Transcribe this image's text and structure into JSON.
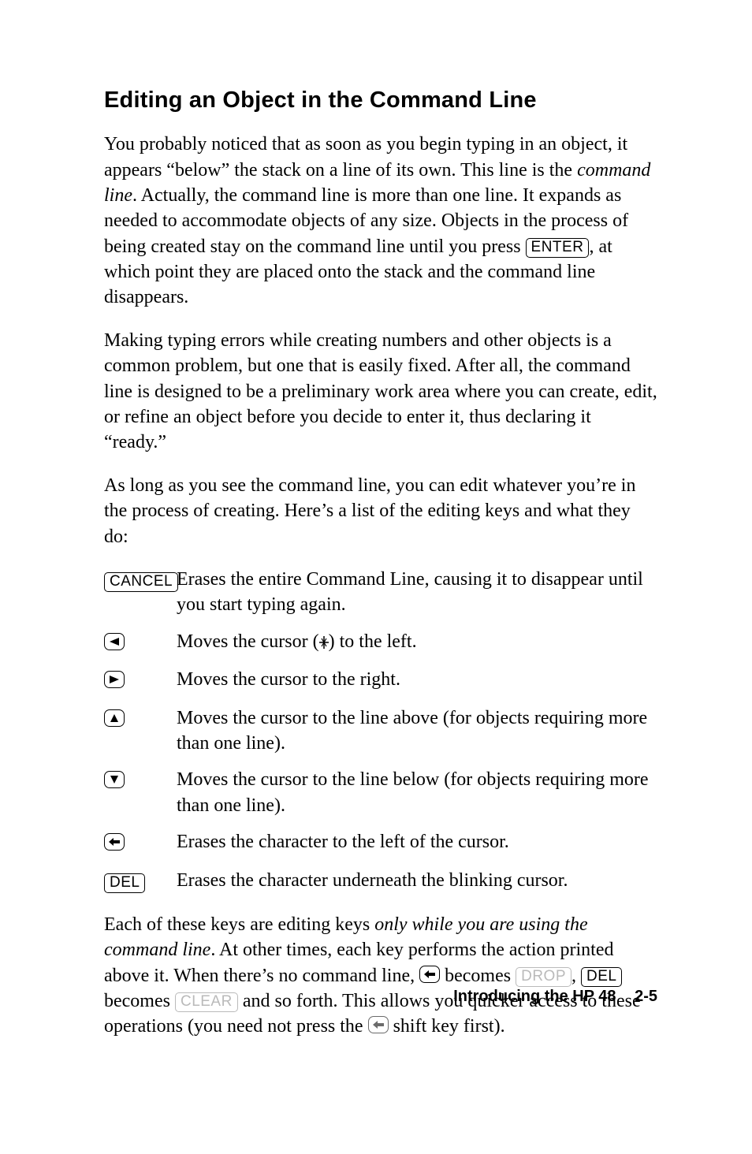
{
  "title": "Editing an Object in the Command Line",
  "p1a": "You probably noticed that as soon as you begin typing in an object, it appears “below” the stack on a line of its own. This line is the ",
  "p1_ital": "command line",
  "p1b": ". Actually, the command line is more than one line. It expands as needed to accommodate objects of any size. Objects in the process of being created stay on the command line until you press ",
  "p1_key": "ENTER",
  "p1c": ", at which point they are placed onto the stack and the command line disappears.",
  "p2": "Making typing errors while creating numbers and other objects is a common problem, but one that is easily fixed. After all, the command line is designed to be a preliminary work area where you can create, edit, or refine an object before you decide to enter it, thus declaring it “ready.”",
  "p3": "As long as you see the command line, you can edit whatever you’re in the process of creating. Here’s a list of the editing keys and what they do:",
  "keys": {
    "cancel": {
      "label": "CANCEL",
      "desc": "Erases the entire Command Line, causing it to disappear until you start typing again."
    },
    "left": {
      "desc_a": "Moves the cursor (",
      "desc_b": ") to the left."
    },
    "right": {
      "desc": "Moves the cursor to the right."
    },
    "up": {
      "desc": "Moves the cursor to the line above (for objects requiring more than one line)."
    },
    "down": {
      "desc": "Moves the cursor to the line below (for objects requiring more than one line)."
    },
    "back": {
      "desc": "Erases the character to the left of the cursor."
    },
    "del": {
      "label": "DEL",
      "desc": "Erases the character underneath the blinking cursor."
    }
  },
  "p4a": "Each of these keys are editing keys ",
  "p4_ital": "only while you are using the command line",
  "p4b": ". At other times, each key performs the action printed above it. When there’s no command line, ",
  "p4c": " becomes ",
  "p4_key_drop": "DROP",
  "p4d": ", ",
  "p4_key_del": "DEL",
  "p4e": " becomes ",
  "p4_key_clear": "CLEAR",
  "p4f": " and so forth. This allows you quicker access to these operations (you need not press the ",
  "p4g": " shift key first).",
  "footer": {
    "text": "Introducing the HP 48",
    "page": "2-5"
  }
}
